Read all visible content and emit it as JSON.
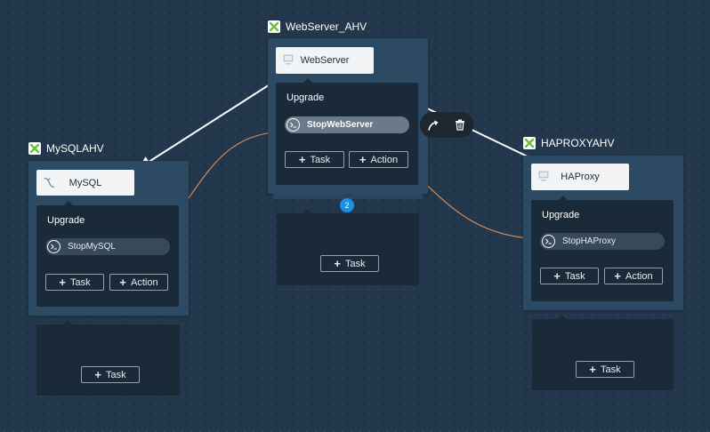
{
  "services": {
    "webserver": {
      "header": "WebServer_AHV",
      "title": "WebServer",
      "stage_title": "Upgrade",
      "task": "StopWebServer",
      "task_button": "Task",
      "action_button": "Action",
      "badge": "2",
      "lower_task_button": "Task"
    },
    "mysql": {
      "header": "MySQLAHV",
      "title": "MySQL",
      "stage_title": "Upgrade",
      "task": "StopMySQL",
      "task_button": "Task",
      "action_button": "Action",
      "lower_task_button": "Task"
    },
    "haproxy": {
      "header": "HAPROXYAHV",
      "title": "HAProxy",
      "stage_title": "Upgrade",
      "task": "StopHAProxy",
      "task_button": "Task",
      "action_button": "Action",
      "lower_task_button": "Task"
    }
  },
  "toolbar": {
    "icons": [
      "edit-connector-icon",
      "trash-icon"
    ]
  },
  "colors": {
    "canvas": "#22374b",
    "card": "#2c4a63",
    "stage": "#1b2a38",
    "dependency_line": "#ffffff",
    "task_link": "#d68a5a",
    "badge": "#1b8fe0"
  },
  "icons": {
    "header": "nutanix-logo-icon",
    "card": "vm-icon",
    "mysql": "mysql-dolphin-icon",
    "task": "shell-prompt-icon"
  }
}
